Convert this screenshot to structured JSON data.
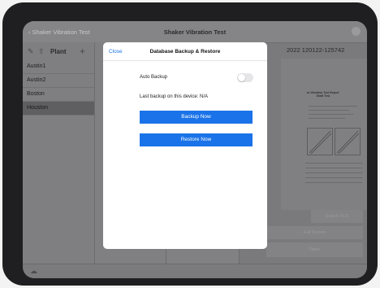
{
  "app": {
    "nav_back": "Shaker Vibration Test",
    "title": "Shaker Vibration Test"
  },
  "sidebar": {
    "plant_label": "Plant",
    "items": [
      {
        "label": "Austin1"
      },
      {
        "label": "Austin2"
      },
      {
        "label": "Boston"
      },
      {
        "label": "Houston",
        "selected": true
      }
    ]
  },
  "detail": {
    "title": "2022 120122-125742",
    "report_title": "ar Vibration Test Report",
    "report_subtitle": "Shaft Test",
    "buttons": {
      "export": "Export XLS",
      "fullscreen": "Full Screen",
      "open": "Open"
    }
  },
  "modal": {
    "close_label": "Close",
    "title": "Database Backup & Restore",
    "auto_backup_label": "Auto Backup",
    "auto_backup_on": false,
    "last_backup": "Last backup on this device: N/A",
    "backup_button": "Backup Now",
    "restore_button": "Restore Now"
  },
  "colors": {
    "accent": "#1a73e8"
  },
  "icons": {
    "back": "chevron-left-icon",
    "edit": "edit-icon",
    "share": "share-icon",
    "add": "plus-icon",
    "status": "status-icon",
    "cloud": "cloud-icon"
  }
}
